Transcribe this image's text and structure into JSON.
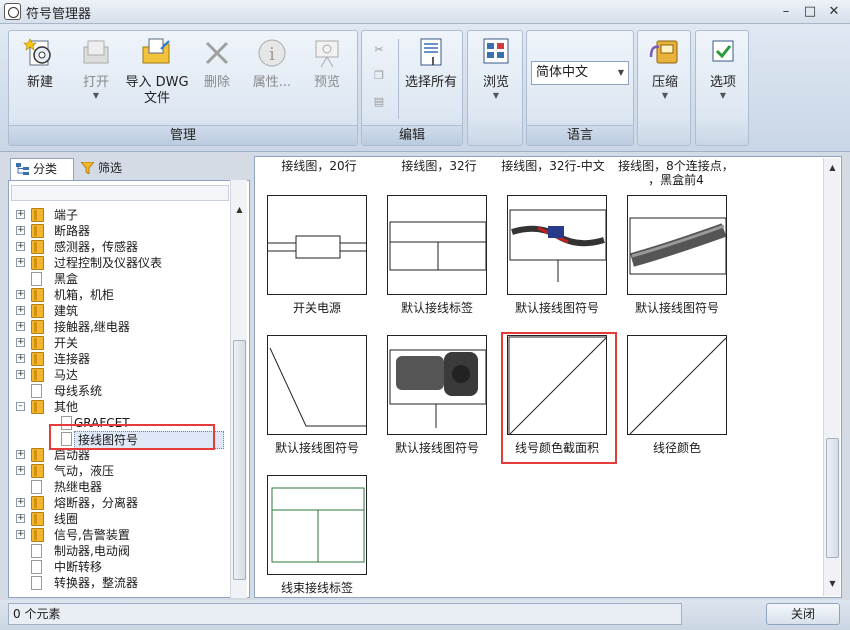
{
  "window": {
    "title": "符号管理器",
    "min": "–",
    "max": "□",
    "close": "✕"
  },
  "ribbon": {
    "groups": {
      "manage": "管理",
      "edit": "编辑",
      "language": "语言"
    },
    "buttons": {
      "new": "新建",
      "open": "打开",
      "import_dwg": [
        "导入 DWG",
        "文件"
      ],
      "delete": "删除",
      "properties": "属性...",
      "preview": "预览",
      "select_all": "选择所有",
      "browse": "浏览",
      "compress": "压缩",
      "options": "选项"
    },
    "language_value": "简体中文"
  },
  "left": {
    "tabs": {
      "category": "分类",
      "filter": "筛选"
    },
    "tree": [
      {
        "label": "端子",
        "kind": "folder",
        "expander": "+"
      },
      {
        "label": "断路器",
        "kind": "folder",
        "expander": "+"
      },
      {
        "label": "感测器，传感器",
        "kind": "folder",
        "expander": "+"
      },
      {
        "label": "过程控制及仪器仪表",
        "kind": "folder",
        "expander": "+"
      },
      {
        "label": "黑盒",
        "kind": "doc",
        "expander": ""
      },
      {
        "label": "机箱，机柜",
        "kind": "folder",
        "expander": "+"
      },
      {
        "label": "建筑",
        "kind": "folder",
        "expander": "+"
      },
      {
        "label": "接触器,继电器",
        "kind": "folder",
        "expander": "+"
      },
      {
        "label": "开关",
        "kind": "folder",
        "expander": "+"
      },
      {
        "label": "连接器",
        "kind": "folder",
        "expander": "+"
      },
      {
        "label": "马达",
        "kind": "folder",
        "expander": "+"
      },
      {
        "label": "母线系统",
        "kind": "doc",
        "expander": ""
      },
      {
        "label": "其他",
        "kind": "folder",
        "expander": "–"
      },
      {
        "label": "GRAFCET",
        "kind": "subdoc",
        "expander": ""
      },
      {
        "label": "接线图符号",
        "kind": "subdoc",
        "expander": "",
        "selected": true
      },
      {
        "label": "启动器",
        "kind": "folder",
        "expander": "+"
      },
      {
        "label": "气动，液压",
        "kind": "folder",
        "expander": "+"
      },
      {
        "label": "热继电器",
        "kind": "doc",
        "expander": ""
      },
      {
        "label": "熔断器，分离器",
        "kind": "folder",
        "expander": "+"
      },
      {
        "label": "线圈",
        "kind": "folder",
        "expander": "+"
      },
      {
        "label": "信号,告警装置",
        "kind": "folder",
        "expander": "+"
      },
      {
        "label": "制动器,电动阀",
        "kind": "doc",
        "expander": ""
      },
      {
        "label": "中断转移",
        "kind": "doc",
        "expander": ""
      },
      {
        "label": "转换器，整流器",
        "kind": "doc",
        "expander": ""
      }
    ]
  },
  "grid": {
    "column_headers": [
      "接线图，20行",
      "接线图，32行",
      "接线图，32行-中文",
      "接线图，8个连接点，",
      "，黑盒前4"
    ],
    "items": [
      "开关电源",
      "默认接线标签",
      "默认接线图符号",
      "默认接线图符号",
      "默认接线图符号",
      "默认接线图符号",
      "线号颜色截面积",
      "线径颜色",
      "线束接线标签"
    ]
  },
  "status": {
    "count": "0 个元素",
    "close": "关闭"
  }
}
